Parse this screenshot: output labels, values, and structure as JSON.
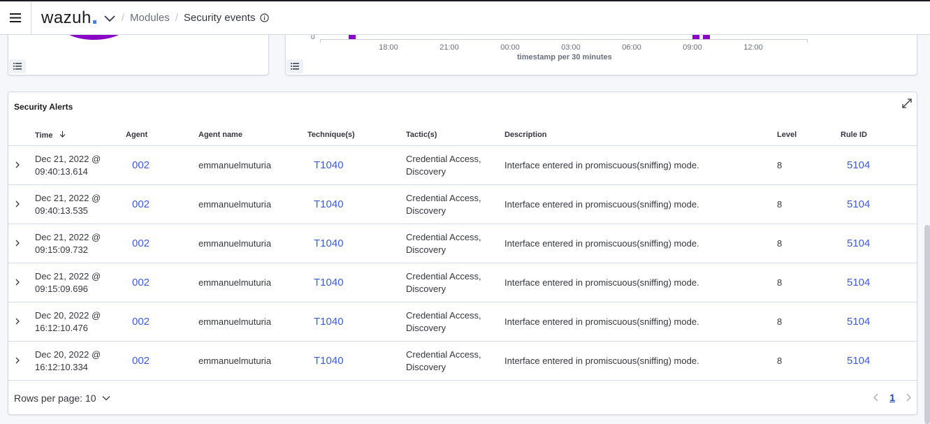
{
  "header": {
    "logo_text": "wazuh",
    "breadcrumb": {
      "modules": "Modules",
      "separator": "/",
      "current": "Security events"
    }
  },
  "timeline": {
    "y_zero": "0",
    "ticks": [
      "18:00",
      "21:00",
      "00:00",
      "03:00",
      "06:00",
      "09:00",
      "12:00"
    ],
    "axis_title": "timestamp per 30 minutes",
    "bar_color": "#8a07c7"
  },
  "alerts": {
    "title": "Security Alerts",
    "columns": {
      "time": "Time",
      "agent": "Agent",
      "agent_name": "Agent name",
      "techniques": "Technique(s)",
      "tactics": "Tactic(s)",
      "description": "Description",
      "level": "Level",
      "rule_id": "Rule ID"
    },
    "rows": [
      {
        "time_date": "Dec 21, 2022 @",
        "time_clock": "09:40:13.614",
        "agent": "002",
        "agent_name": "emmanuelmuturia",
        "technique": "T1040",
        "tactic_1": "Credential Access,",
        "tactic_2": "Discovery",
        "description": "Interface entered in promiscuous(sniffing) mode.",
        "level": "8",
        "rule_id": "5104"
      },
      {
        "time_date": "Dec 21, 2022 @",
        "time_clock": "09:40:13.535",
        "agent": "002",
        "agent_name": "emmanuelmuturia",
        "technique": "T1040",
        "tactic_1": "Credential Access,",
        "tactic_2": "Discovery",
        "description": "Interface entered in promiscuous(sniffing) mode.",
        "level": "8",
        "rule_id": "5104"
      },
      {
        "time_date": "Dec 21, 2022 @",
        "time_clock": "09:15:09.732",
        "agent": "002",
        "agent_name": "emmanuelmuturia",
        "technique": "T1040",
        "tactic_1": "Credential Access,",
        "tactic_2": "Discovery",
        "description": "Interface entered in promiscuous(sniffing) mode.",
        "level": "8",
        "rule_id": "5104"
      },
      {
        "time_date": "Dec 21, 2022 @",
        "time_clock": "09:15:09.696",
        "agent": "002",
        "agent_name": "emmanuelmuturia",
        "technique": "T1040",
        "tactic_1": "Credential Access,",
        "tactic_2": "Discovery",
        "description": "Interface entered in promiscuous(sniffing) mode.",
        "level": "8",
        "rule_id": "5104"
      },
      {
        "time_date": "Dec 20, 2022 @",
        "time_clock": "16:12:10.476",
        "agent": "002",
        "agent_name": "emmanuelmuturia",
        "technique": "T1040",
        "tactic_1": "Credential Access,",
        "tactic_2": "Discovery",
        "description": "Interface entered in promiscuous(sniffing) mode.",
        "level": "8",
        "rule_id": "5104"
      },
      {
        "time_date": "Dec 20, 2022 @",
        "time_clock": "16:12:10.334",
        "agent": "002",
        "agent_name": "emmanuelmuturia",
        "technique": "T1040",
        "tactic_1": "Credential Access,",
        "tactic_2": "Discovery",
        "description": "Interface entered in promiscuous(sniffing) mode.",
        "level": "8",
        "rule_id": "5104"
      }
    ],
    "footer": {
      "rows_per_page": "Rows per page: 10",
      "current_page": "1"
    }
  },
  "colors": {
    "link": "#3b5bdb",
    "accent_purple": "#8a07c7",
    "border": "#d3dae6"
  }
}
